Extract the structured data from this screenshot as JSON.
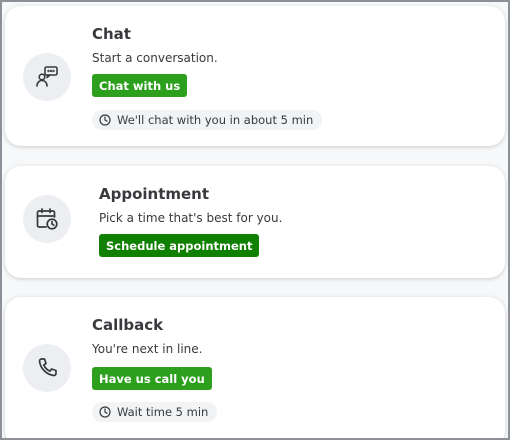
{
  "chat": {
    "title": "Chat",
    "description": "Start a conversation.",
    "button_label": "Chat with us",
    "wait_text": "We'll chat with you in about 5 min",
    "icon": "chat-icon"
  },
  "appointment": {
    "title": "Appointment",
    "description": "Pick a time that's best for you.",
    "button_label": "Schedule appointment",
    "icon": "calendar-clock-icon"
  },
  "callback": {
    "title": "Callback",
    "description": "You're next in line.",
    "button_label": "Have us call you",
    "wait_text": "Wait time 5 min",
    "icon": "phone-icon"
  },
  "colors": {
    "primary_button": "#2ca01c",
    "secondary_button": "#108000",
    "text": "#393a3d",
    "icon_circle": "#eceef1",
    "pill_bg": "#f1f3f5"
  }
}
